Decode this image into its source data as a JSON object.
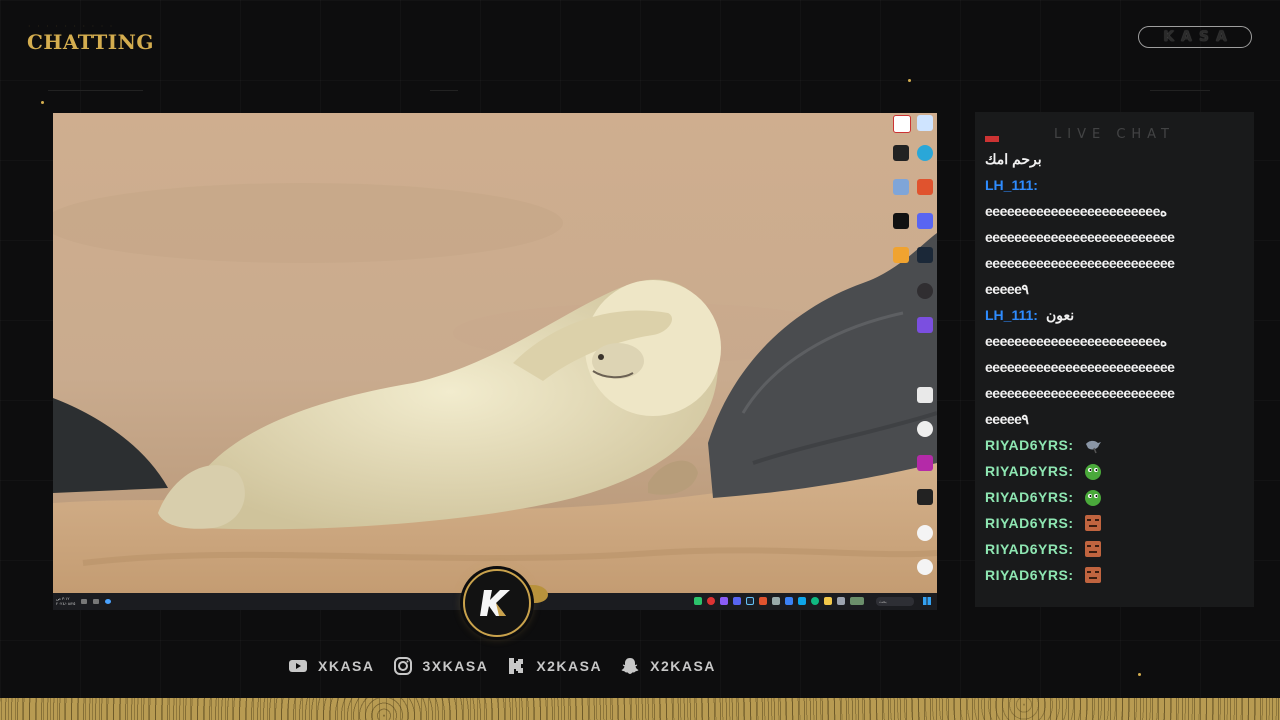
{
  "overlay": {
    "scene_label": "CHATTING",
    "brand": "KASA",
    "accent": "#c9a24c"
  },
  "screen": {
    "wallpaper_subject": "seal-pup-covering-face",
    "taskbar": {
      "clock_time": "٣:١٢ ص",
      "clock_date": "٢٠٢٤/٠٨/٢٥",
      "search_placeholder": "بحث"
    }
  },
  "chat": {
    "title": "LIVE CHAT",
    "messages": [
      {
        "user": "",
        "text": "برحم امك",
        "style": "text"
      },
      {
        "user": "LH_111:",
        "text": "",
        "style": "blue"
      },
      {
        "user": "",
        "text": "هeeeeeeeeeeeeeeeeeeeeeeee",
        "style": "text"
      },
      {
        "user": "",
        "text": "eeeeeeeeeeeeeeeeeeeeeeeeee",
        "style": "text"
      },
      {
        "user": "",
        "text": "eeeeeeeeeeeeeeeeeeeeeeeeee",
        "style": "text"
      },
      {
        "user": "",
        "text": "eeeee٩",
        "style": "text"
      },
      {
        "user": "LH_111:",
        "text": "نعون",
        "style": "blue"
      },
      {
        "user": "",
        "text": "هeeeeeeeeeeeeeeeeeeeeeeee",
        "style": "text"
      },
      {
        "user": "",
        "text": "eeeeeeeeeeeeeeeeeeeeeeeeee",
        "style": "text"
      },
      {
        "user": "",
        "text": "eeeeeeeeeeeeeeeeeeeeeeeeee",
        "style": "text"
      },
      {
        "user": "",
        "text": "eeeee٩",
        "style": "text"
      },
      {
        "user": "RIYAD6YRS:",
        "emote": "bird-emote",
        "style": "green"
      },
      {
        "user": "RIYAD6YRS:",
        "emote": "pepe-emote",
        "style": "green"
      },
      {
        "user": "RIYAD6YRS:",
        "emote": "pepe-emote",
        "style": "green"
      },
      {
        "user": "RIYAD6YRS:",
        "emote": "face-emote",
        "style": "green"
      },
      {
        "user": "RIYAD6YRS:",
        "emote": "face-emote",
        "style": "green"
      },
      {
        "user": "RIYAD6YRS:",
        "emote": "face-emote",
        "style": "green"
      }
    ]
  },
  "socials": [
    {
      "icon": "youtube-icon",
      "label": "XKASA"
    },
    {
      "icon": "instagram-icon",
      "label": "3XKASA"
    },
    {
      "icon": "kick-icon",
      "label": "X2KASA"
    },
    {
      "icon": "snapchat-icon",
      "label": "X2KASA"
    }
  ]
}
